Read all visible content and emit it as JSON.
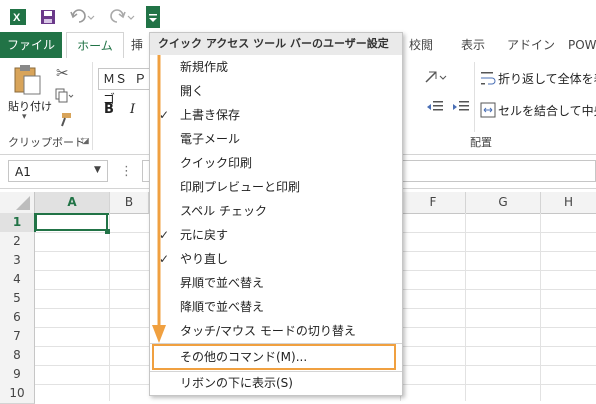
{
  "titlebar": {
    "app_icon": "excel-icon",
    "save_icon": "save-icon",
    "undo_icon": "undo-icon",
    "redo_icon": "redo-icon",
    "qat_dropdown_icon": "customize-qat-icon"
  },
  "tabs": [
    {
      "label": "ファイル"
    },
    {
      "label": "ホーム"
    },
    {
      "label": "挿"
    },
    {
      "label": "校閲"
    },
    {
      "label": "表示"
    },
    {
      "label": "アドイン"
    },
    {
      "label": "POW"
    }
  ],
  "ribbon": {
    "paste_label": "貼り付け",
    "clipboard_group": "クリップボード",
    "font_name": "ＭＳ Ｐゴ",
    "bold": "B",
    "italic": "I",
    "wrap_text": "折り返して全体を表示",
    "merge_center": "セルを結合して中央揃",
    "alignment_group": "配置"
  },
  "formula_bar": {
    "name_box": "A1",
    "fx_separator": "⋮"
  },
  "grid": {
    "columns": [
      "A",
      "B",
      "F",
      "G",
      "H"
    ],
    "rows": [
      "1",
      "2",
      "3",
      "4",
      "5",
      "6",
      "7",
      "8",
      "9",
      "10"
    ],
    "accent": "#217346"
  },
  "menu": {
    "header": "クイック アクセス ツール バーのユーザー設定",
    "items": [
      {
        "label": "新規作成",
        "checked": false
      },
      {
        "label": "開く",
        "checked": false
      },
      {
        "label": "上書き保存",
        "checked": true
      },
      {
        "label": "電子メール",
        "checked": false
      },
      {
        "label": "クイック印刷",
        "checked": false
      },
      {
        "label": "印刷プレビューと印刷",
        "checked": false
      },
      {
        "label": "スペル チェック",
        "checked": false
      },
      {
        "label": "元に戻す",
        "checked": true
      },
      {
        "label": "やり直し",
        "checked": true
      },
      {
        "label": "昇順で並べ替え",
        "checked": false
      },
      {
        "label": "降順で並べ替え",
        "checked": false
      },
      {
        "label": "タッチ/マウス モードの切り替え",
        "checked": false
      }
    ],
    "more_commands": "その他のコマンド(M)...",
    "show_below": "リボンの下に表示(S)",
    "highlight_color": "#f0a040",
    "arrow_color": "#f0a040"
  }
}
